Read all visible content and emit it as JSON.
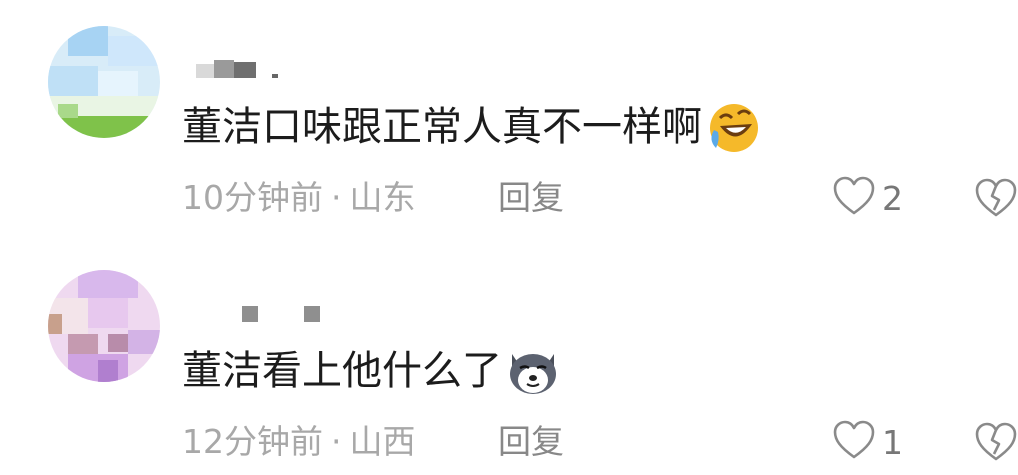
{
  "comments": [
    {
      "text": "董洁口味跟正常人真不一样啊",
      "emoji": "laughing-crying-face",
      "time": "10分钟前",
      "separator": "·",
      "location": "山东",
      "reply_label": "回复",
      "likes": "2",
      "like_icon": "heart-outline-icon",
      "dislike_icon": "broken-heart-icon"
    },
    {
      "text": "董洁看上他什么了",
      "emoji": "husky-dog-face",
      "time": "12分钟前",
      "separator": "·",
      "location": "山西",
      "reply_label": "回复",
      "likes": "1",
      "like_icon": "heart-outline-icon",
      "dislike_icon": "broken-heart-icon"
    }
  ]
}
